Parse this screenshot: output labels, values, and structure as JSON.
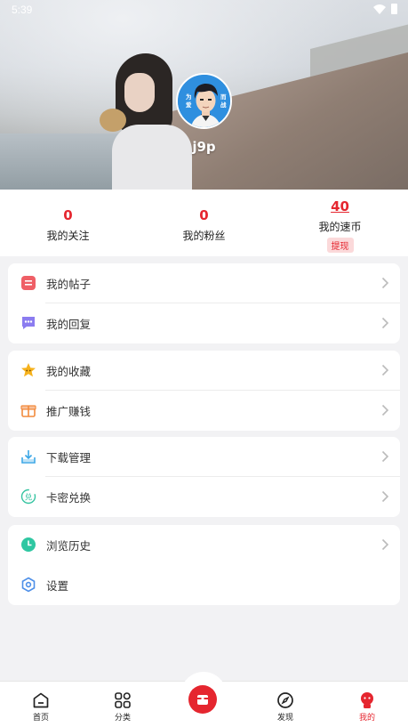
{
  "status_bar": {
    "time": "5:39"
  },
  "profile": {
    "username": "j9p",
    "avatar_text_left": "为 爱",
    "avatar_text_right": "而 战"
  },
  "stats": [
    {
      "value": "0",
      "label": "我的关注"
    },
    {
      "value": "0",
      "label": "我的粉丝"
    },
    {
      "value": "40",
      "label": "我的速币",
      "action": "提现"
    }
  ],
  "menu": {
    "group1": [
      {
        "label": "我的帖子",
        "icon": "post-icon"
      },
      {
        "label": "我的回复",
        "icon": "reply-icon"
      }
    ],
    "group2": [
      {
        "label": "我的收藏",
        "icon": "star-icon"
      },
      {
        "label": "推广赚钱",
        "icon": "gift-icon"
      }
    ],
    "group3": [
      {
        "label": "下载管理",
        "icon": "download-icon"
      },
      {
        "label": "卡密兑换",
        "icon": "exchange-icon"
      }
    ],
    "group4": [
      {
        "label": "浏览历史",
        "icon": "clock-icon"
      },
      {
        "label": "设置",
        "icon": "settings-icon"
      }
    ]
  },
  "bottom_nav": [
    {
      "label": "首页",
      "icon": "home-icon"
    },
    {
      "label": "分类",
      "icon": "grid-icon"
    },
    {
      "label": "",
      "icon": "center-action-icon"
    },
    {
      "label": "发现",
      "icon": "compass-icon"
    },
    {
      "label": "我的",
      "icon": "profile-icon",
      "active": true
    }
  ],
  "colors": {
    "accent": "#e5262f",
    "background": "#f2f2f4"
  }
}
